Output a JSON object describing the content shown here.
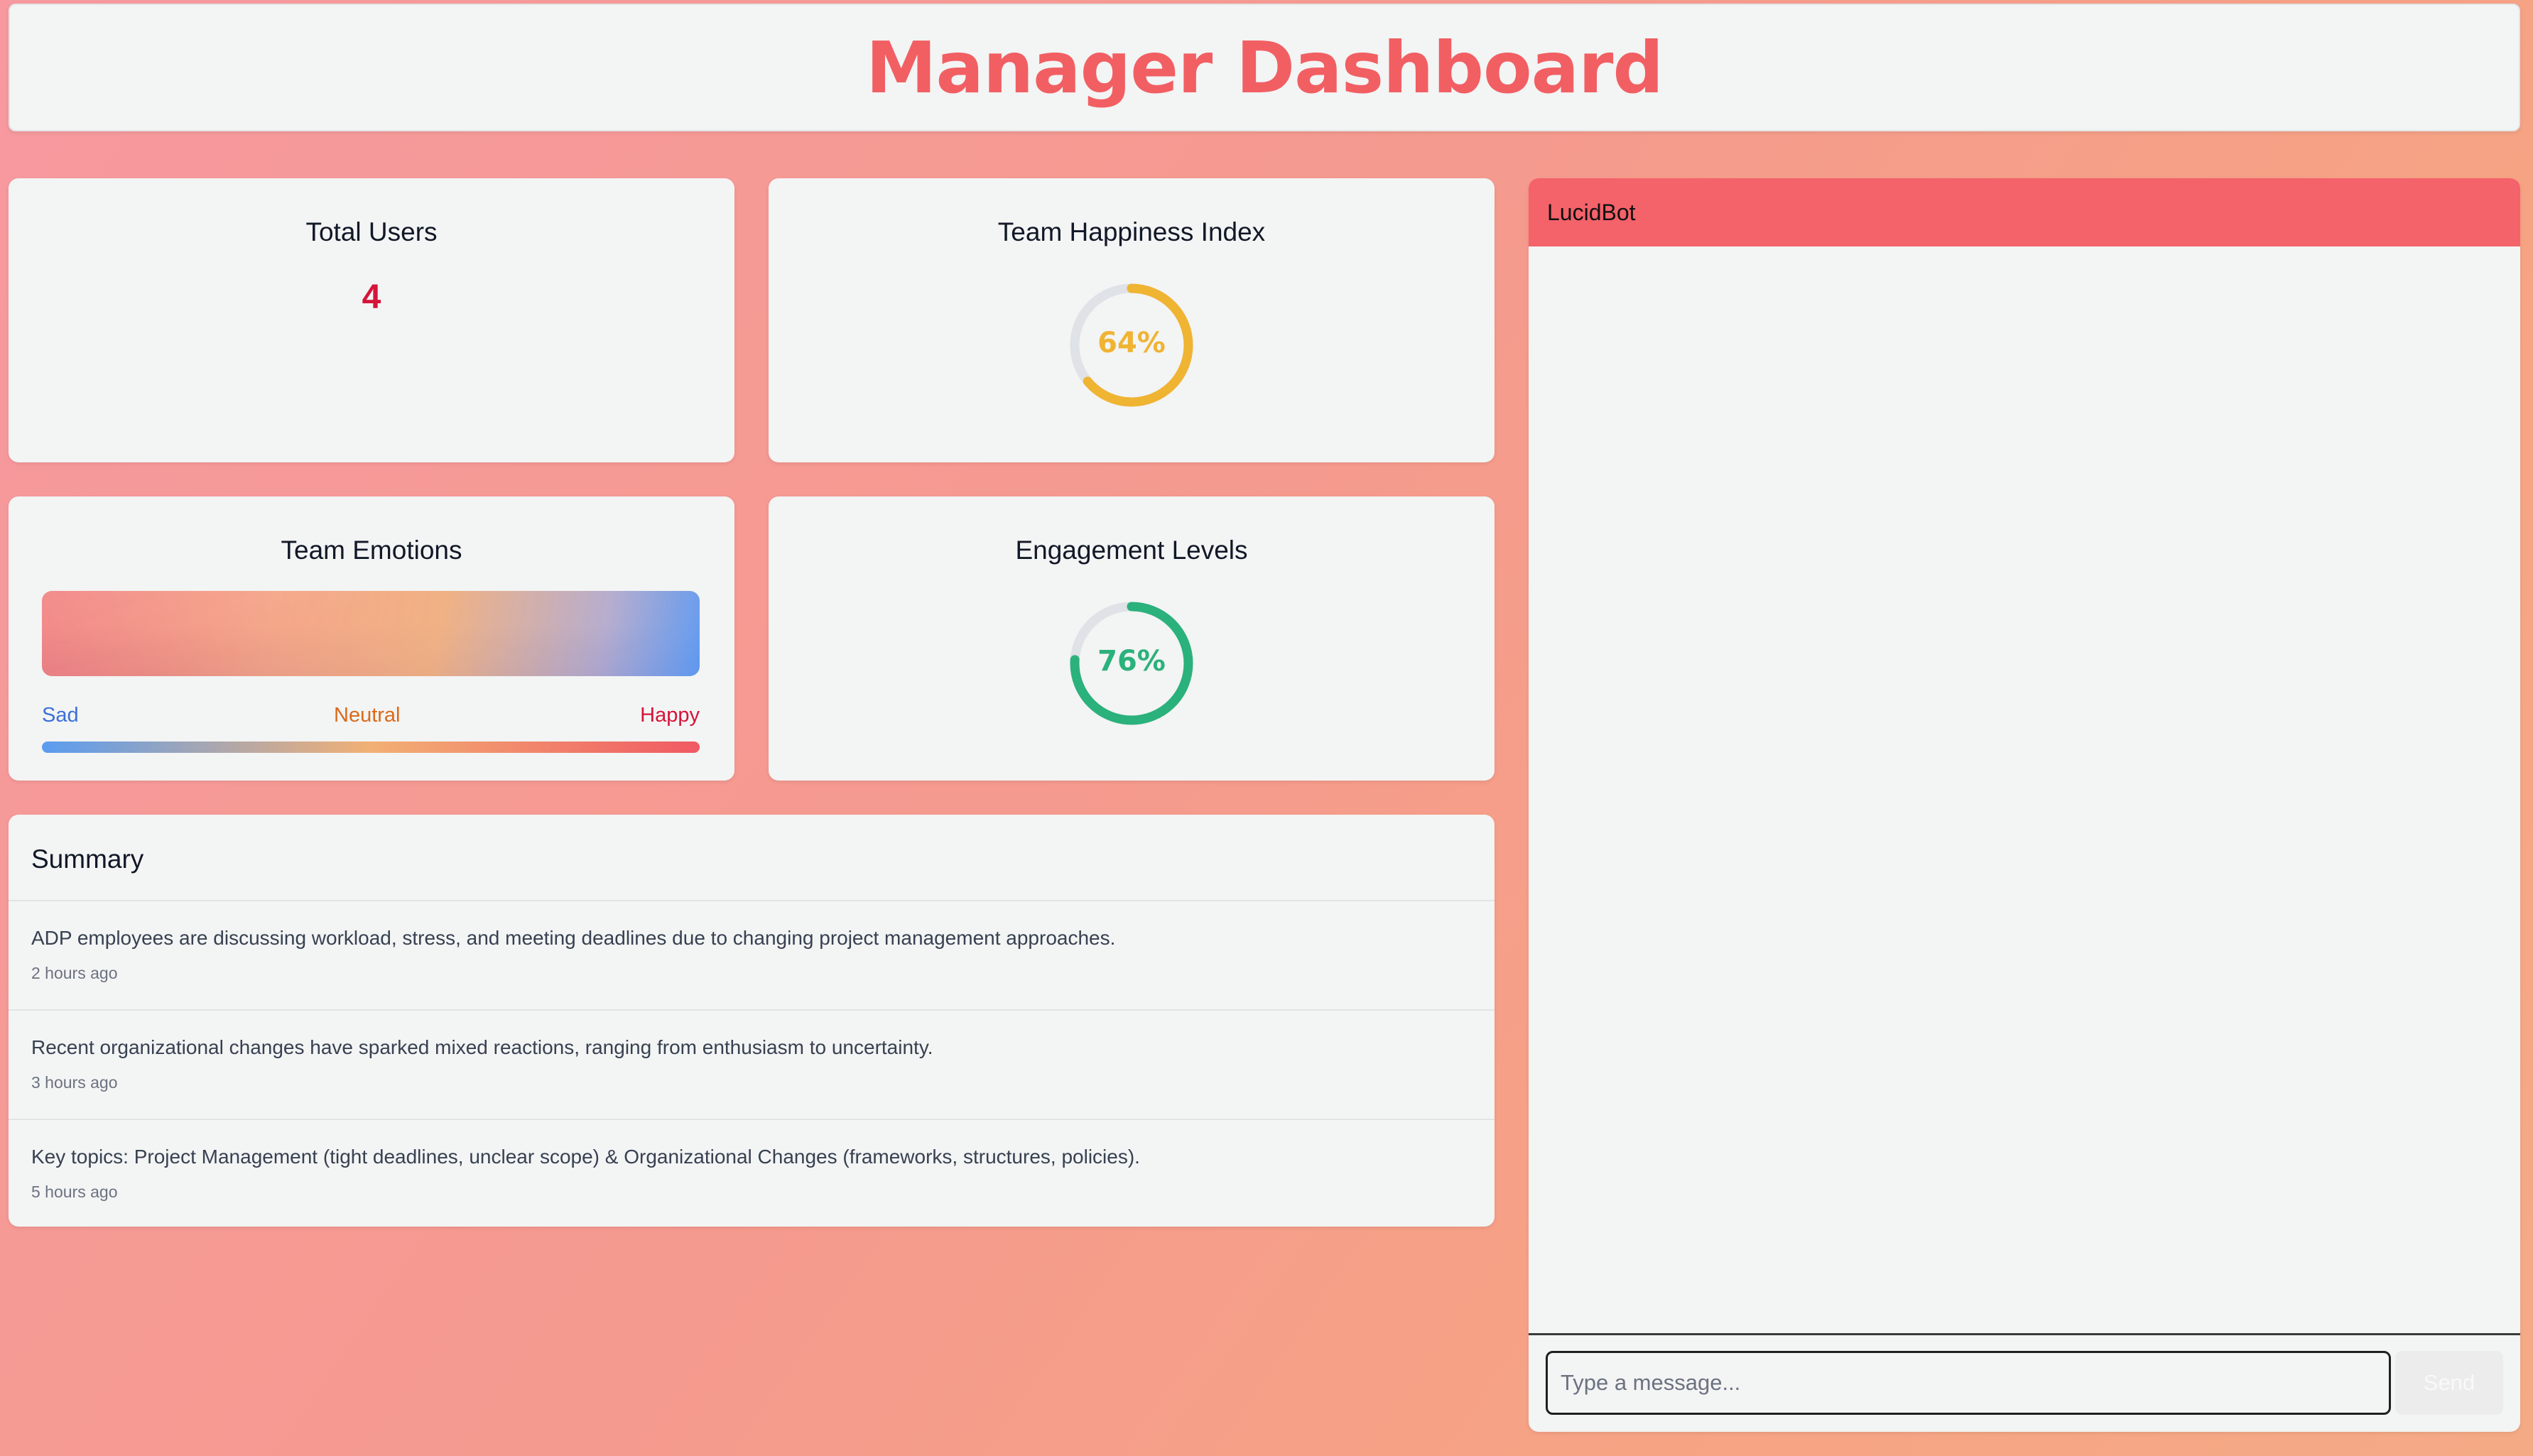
{
  "header": {
    "title": "Manager Dashboard"
  },
  "stats": {
    "total_users": {
      "title": "Total Users",
      "value": "4"
    },
    "happiness": {
      "title": "Team Happiness Index",
      "value": 0.64,
      "label": "64%",
      "color": "#f0b433"
    },
    "emotions": {
      "title": "Team Emotions",
      "scale": {
        "low": "Sad",
        "mid": "Neutral",
        "high": "Happy"
      },
      "colors": {
        "low": "#3a70d8",
        "mid": "#d96a1a",
        "high": "#d5143a"
      }
    },
    "engagement": {
      "title": "Engagement Levels",
      "value": 0.76,
      "label": "76%",
      "color": "#2bb17c"
    }
  },
  "summary": {
    "title": "Summary",
    "items": [
      {
        "text": "ADP employees are discussing workload, stress, and meeting deadlines due to changing project management approaches.",
        "time": "2 hours ago"
      },
      {
        "text": "Recent organizational changes have sparked mixed reactions, ranging from enthusiasm to uncertainty.",
        "time": "3 hours ago"
      },
      {
        "text": "Key topics: Project Management (tight deadlines, unclear scope) & Organizational Changes (frameworks, structures, policies).",
        "time": "5 hours ago"
      }
    ]
  },
  "chat": {
    "title": "LucidBot",
    "input_value": "",
    "input_placeholder": "Type a message...",
    "send_label": "Send"
  }
}
